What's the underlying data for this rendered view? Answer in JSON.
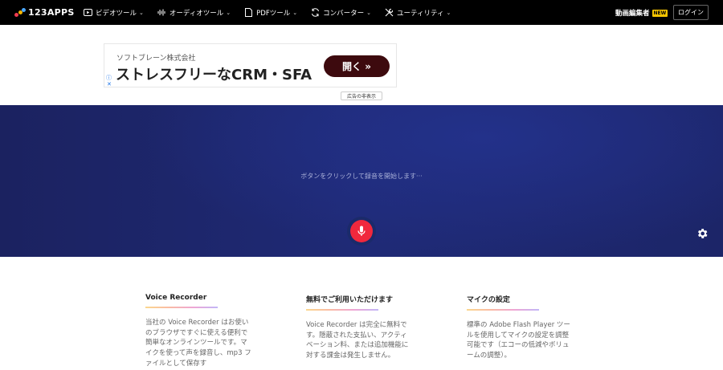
{
  "nav": {
    "logo": "123APPS",
    "menu": [
      {
        "label": "ビデオツール",
        "icon": "video-icon"
      },
      {
        "label": "オーディオツール",
        "icon": "audio-wave-icon"
      },
      {
        "label": "PDFツール",
        "icon": "pdf-icon"
      },
      {
        "label": "コンバーター",
        "icon": "convert-icon"
      },
      {
        "label": "ユーティリティ",
        "icon": "tools-icon"
      }
    ],
    "promo": "動画編集者",
    "promo_badge": "NEW",
    "login": "ログイン"
  },
  "ad": {
    "company": "ソフトブレーン株式会社",
    "headline": "ストレスフリーなCRM・SFA",
    "button": "開く »",
    "hide": "広告の非表示"
  },
  "hero": {
    "text": "ボタンをクリックして録音を開始します···"
  },
  "info": [
    {
      "title": "Voice Recorder",
      "body": "当社の Voice Recorder はお使いのブラウザですぐに使える便利で簡単なオンラインツールです。マイクを使って声を録音し、mp3 ファイルとして保存す"
    },
    {
      "title": "無料でご利用いただけます",
      "body": "Voice Recorder は完全に無料です。隠蔽された支払い、アクティベーション料、または追加機能に対する課金は発生しません。"
    },
    {
      "title": "マイクの設定",
      "body": "標準の Adobe Flash Player ツールを使用してマイクの設定を調整可能です（エコーの低減やボリュームの調整）。"
    }
  ],
  "colors": {
    "nav_bg": "#000000",
    "hero_bg": "#1f2a76",
    "mic_red": "#f0283d",
    "ad_button": "#3d0a0e"
  }
}
